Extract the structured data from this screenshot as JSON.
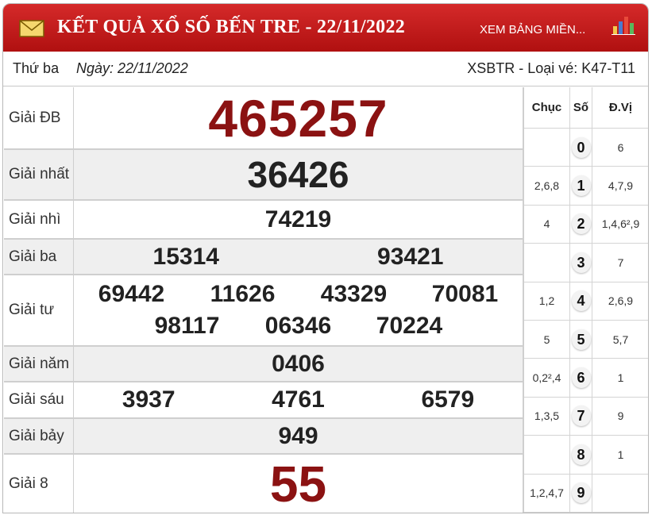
{
  "header": {
    "title": "KẾT QUẢ XỔ SỐ BẾN TRE - 22/11/2022",
    "link_label": "XEM BẢNG MIỀN...",
    "icons": [
      "envelope-icon",
      "bar-chart-icon"
    ],
    "color": "#c41a1a"
  },
  "info": {
    "day": "Thứ ba",
    "date": "Ngày: 22/11/2022",
    "code": "XSBTR - Loại vé: K47-T11"
  },
  "prizes": {
    "db": {
      "label": "Giải ĐB",
      "numbers": [
        "465257"
      ]
    },
    "g1": {
      "label": "Giải nhất",
      "numbers": [
        "36426"
      ]
    },
    "g2": {
      "label": "Giải nhì",
      "numbers": [
        "74219"
      ]
    },
    "g3": {
      "label": "Giải ba",
      "numbers": [
        "15314",
        "93421"
      ]
    },
    "g4": {
      "label": "Giải tư",
      "numbers": [
        "69442",
        "11626",
        "43329",
        "70081",
        "98117",
        "06346",
        "70224"
      ]
    },
    "g5": {
      "label": "Giải năm",
      "numbers": [
        "0406"
      ]
    },
    "g6": {
      "label": "Giải sáu",
      "numbers": [
        "3937",
        "4761",
        "6579"
      ]
    },
    "g7": {
      "label": "Giải bảy",
      "numbers": [
        "949"
      ]
    },
    "g8": {
      "label": "Giải 8",
      "numbers": [
        "55"
      ]
    }
  },
  "loto": {
    "headers": {
      "chuc": "Chục",
      "so": "Số",
      "dv": "Đ.Vị"
    },
    "rows": [
      {
        "chuc": "",
        "so": "0",
        "dv": "6"
      },
      {
        "chuc": "2,6,8",
        "so": "1",
        "dv": "4,7,9"
      },
      {
        "chuc": "4",
        "so": "2",
        "dv": "1,4,6²,9"
      },
      {
        "chuc": "",
        "so": "3",
        "dv": "7"
      },
      {
        "chuc": "1,2",
        "so": "4",
        "dv": "2,6,9"
      },
      {
        "chuc": "5",
        "so": "5",
        "dv": "5,7"
      },
      {
        "chuc": "0,2²,4",
        "so": "6",
        "dv": "1"
      },
      {
        "chuc": "1,3,5",
        "so": "7",
        "dv": "9"
      },
      {
        "chuc": "",
        "so": "8",
        "dv": "1"
      },
      {
        "chuc": "1,2,4,7",
        "so": "9",
        "dv": ""
      }
    ]
  }
}
